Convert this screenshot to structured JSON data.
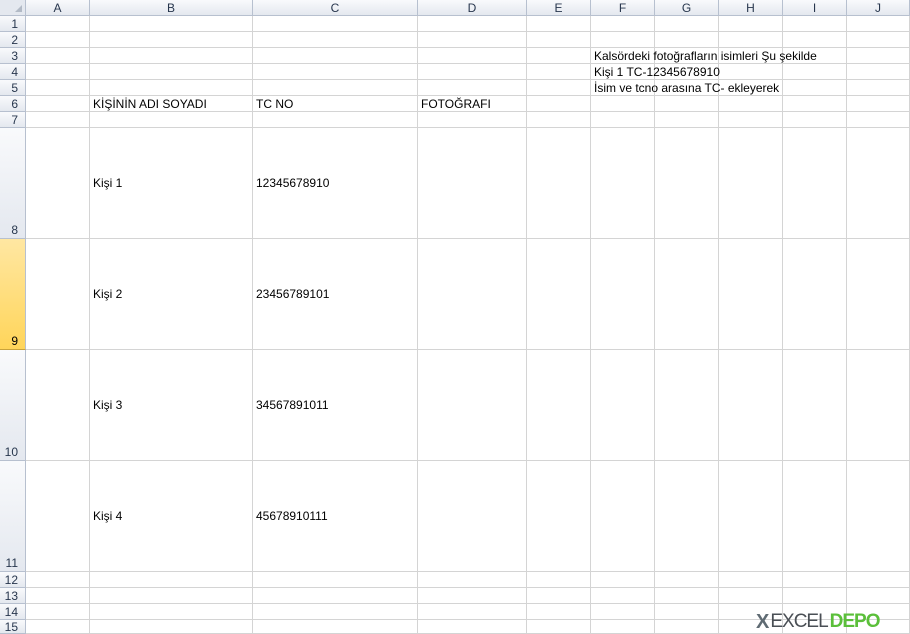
{
  "columns": [
    "A",
    "B",
    "C",
    "D",
    "E",
    "F",
    "G",
    "H",
    "I",
    "J"
  ],
  "rows": [
    "1",
    "2",
    "3",
    "4",
    "5",
    "6",
    "7",
    "8",
    "9",
    "10",
    "11",
    "12",
    "13",
    "14",
    "15"
  ],
  "selected_row": "9",
  "notes": {
    "line1": "Kalsördeki fotoğrafların isimleri Şu şekilde",
    "line2": "Kişi 1 TC-12345678910",
    "line3": "İsim ve tcno arasına TC- ekleyerek"
  },
  "headers": {
    "name": "KİŞİNİN ADI SOYADI",
    "tc": "TC NO",
    "photo": "FOTOĞRAFI"
  },
  "people": [
    {
      "name": "Kişi 1",
      "tc": "12345678910"
    },
    {
      "name": "Kişi 2",
      "tc": "23456789101"
    },
    {
      "name": "Kişi 3",
      "tc": "34567891011"
    },
    {
      "name": "Kişi 4",
      "tc": "45678910111"
    }
  ],
  "watermark": {
    "mark": "X",
    "word1": "EXCEL",
    "word2": "DEPO"
  },
  "colors": {
    "header_bg": "#e4e8ef",
    "selected_row_bg": "#ffd55a",
    "gridline": "#d4d4d4",
    "logo_green": "#5bbf3a"
  }
}
